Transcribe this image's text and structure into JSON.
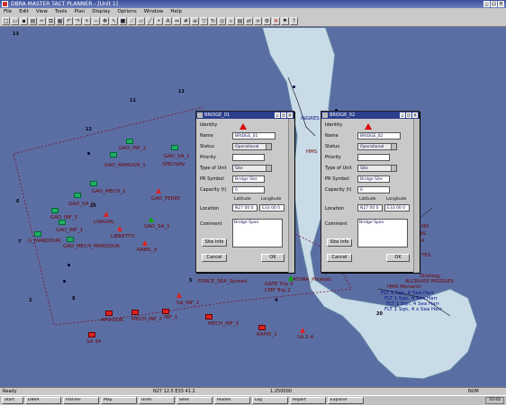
{
  "window": {
    "title": "DBRA MASTER TACT PLANNER - [Unit 1]"
  },
  "menu": [
    "File",
    "Edit",
    "View",
    "Tools",
    "Plan",
    "Display",
    "Options",
    "Window",
    "Help"
  ],
  "toolbar_icons": [
    "new-icon",
    "open-icon",
    "save-icon",
    "print-icon",
    "cut-icon",
    "copy-icon",
    "paste-icon",
    "undo-icon",
    "redo-icon",
    "zoom-in-icon",
    "zoom-out-icon",
    "pan-icon",
    "select-icon",
    "unit-icon",
    "route-icon",
    "area-icon",
    "line-icon",
    "point-icon",
    "text-icon",
    "measure-icon",
    "grid-icon",
    "layer-icon",
    "filter-icon",
    "refresh-icon",
    "center-icon",
    "find-icon",
    "report-icon",
    "sync-icon",
    "link-icon",
    "settings-icon",
    "delete-icon",
    "flag-icon",
    "help-icon"
  ],
  "map": {
    "units": [
      {
        "label": "GAO_INF_2",
        "color": "green"
      },
      {
        "label": "GAO_ARMOUR_1",
        "color": "green"
      },
      {
        "label": "GAO_SA_1",
        "color": "green"
      },
      {
        "label": "SPECNAV",
        "color": "red"
      },
      {
        "label": "GAO_MECH_2",
        "color": "green"
      },
      {
        "label": "GAO_FERRY",
        "color": "red"
      },
      {
        "label": "GAO_SA_2",
        "color": "green"
      },
      {
        "label": "GAO_INF_5",
        "color": "green"
      },
      {
        "label": "LSRGWL",
        "color": "red"
      },
      {
        "label": "GAO_INF_1",
        "color": "green"
      },
      {
        "label": "LIBRETTO",
        "color": "red"
      },
      {
        "label": "GAO_SA_1",
        "color": "green"
      },
      {
        "label": "G_MANDOUR",
        "color": "red"
      },
      {
        "label": "GAO_MECH_MANDOUR",
        "color": "red"
      },
      {
        "label": "NABIL_II",
        "color": "red"
      },
      {
        "label": "SA_INF_2",
        "color": "red"
      },
      {
        "label": "INF_1",
        "color": "red"
      },
      {
        "label": "MECH_INF_2",
        "color": "red"
      },
      {
        "label": "APIADOR",
        "color": "red"
      },
      {
        "label": "MECH_INF_3",
        "color": "red"
      },
      {
        "label": "SA 34",
        "color": "red"
      },
      {
        "label": "RAPID_1",
        "color": "red"
      },
      {
        "label": "SA 2-4",
        "color": "red"
      },
      {
        "label": "FORCE_SEA_Spread",
        "color": "red"
      },
      {
        "label": "ATORA_Phiallab",
        "color": "green"
      },
      {
        "label": "GATE Trip 3",
        "color": "red"
      },
      {
        "label": "CMF Trip 2",
        "color": "red"
      },
      {
        "label": "INGRES",
        "color": "blue"
      },
      {
        "label": "HMS",
        "color": "red"
      },
      {
        "label": "Strategy",
        "color": "red"
      },
      {
        "label": "ALCRUISE MISSILES",
        "color": "red"
      },
      {
        "label": "HMS Monarch",
        "color": "red"
      },
      {
        "label": "FLT 1 Sqn, 6 Sea Harr",
        "color": "blue"
      },
      {
        "label": "FLT 1 Sqn, 4 Sea Harr",
        "color": "blue"
      },
      {
        "label": "FLT 1 Sqn, 4 Sea Harr",
        "color": "blue"
      },
      {
        "label": "FLT 1 Sqn, 4 x Sea Harr",
        "color": "blue"
      }
    ],
    "grid_numbers": [
      "13",
      "11",
      "11",
      "12",
      "7",
      "15",
      "6",
      "8",
      "2",
      "4",
      "5",
      "20"
    ],
    "right_edge_labels": [
      "ND",
      "HIS",
      "44",
      "TEX"
    ]
  },
  "dialog_left": {
    "title": "BRIDGE_01",
    "fields": {
      "label_name": "Name",
      "name": "BRIDGE_01",
      "label_status": "Status",
      "status": "Operational",
      "label_priority": "Priority",
      "priority": "",
      "label_type": "Type of Unit",
      "type": "Site",
      "label_symbol": "PR Symbol",
      "symbol": "Bridge Site",
      "label_capacity": "Capacity (t)",
      "capacity": "0",
      "label_location": "Location",
      "label_latitude": "Latitude",
      "latitude": "N27 00 0",
      "label_longitude": "Longitude",
      "longitude": "E33 00 0",
      "label_comment": "Comment",
      "comment": "Bridge Span",
      "label_site_info": "Site Info"
    },
    "buttons": {
      "cancel": "Cancel",
      "ok": "OK"
    },
    "identity_label": "Identity"
  },
  "dialog_right": {
    "title": "BRIDGE_02",
    "fields": {
      "label_name": "Name",
      "name": "BRIDGE_02",
      "label_status": "Status",
      "status": "Operational",
      "label_priority": "Priority",
      "priority": "",
      "label_type": "Type of Unit",
      "type": "Site",
      "label_symbol": "PR Symbol",
      "symbol": "Bridge Site",
      "label_capacity": "Capacity (t)",
      "capacity": "0",
      "label_location": "Location",
      "label_latitude": "Latitude",
      "latitude": "N27 00 0",
      "label_longitude": "Longitude",
      "longitude": "E33 00 0",
      "label_comment": "Comment",
      "comment": "Bridge Span",
      "label_site_info": "Site Info"
    },
    "buttons": {
      "cancel": "Cancel",
      "ok": "OK"
    },
    "identity_label": "Identity"
  },
  "status": {
    "left": "Ready",
    "coords": "N27 12.5 E33 41.2",
    "scale": "1:250000",
    "mode": "NUM"
  },
  "taskbar": {
    "items": [
      "Start",
      "DBRA",
      "Planner",
      "Map",
      "Units",
      "Sites",
      "Routes",
      "Log",
      "Report",
      "Explorer"
    ],
    "clock": "10:42"
  }
}
